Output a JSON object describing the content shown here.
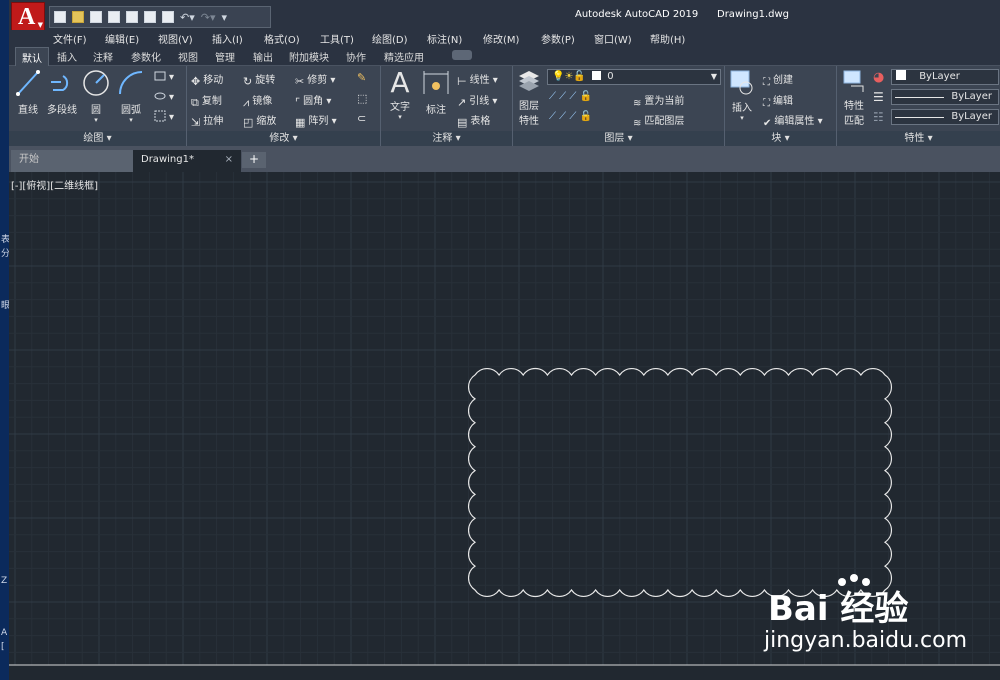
{
  "app": {
    "title": "Autodesk AutoCAD 2019",
    "document": "Drawing1.dwg",
    "logo_letter": "A"
  },
  "menu": [
    "文件(F)",
    "编辑(E)",
    "视图(V)",
    "插入(I)",
    "格式(O)",
    "工具(T)",
    "绘图(D)",
    "标注(N)",
    "修改(M)",
    "参数(P)",
    "窗口(W)",
    "帮助(H)"
  ],
  "ribbon_tabs": [
    "默认",
    "插入",
    "注释",
    "参数化",
    "视图",
    "管理",
    "输出",
    "附加模块",
    "协作",
    "精选应用"
  ],
  "ribbon": {
    "draw": {
      "title": "绘图 ▾",
      "line": "直线",
      "polyline": "多段线",
      "circle": "圆",
      "arc": "圆弧"
    },
    "modify": {
      "title": "修改 ▾",
      "move": "移动",
      "rotate": "旋转",
      "trim": "修剪",
      "copy": "复制",
      "mirror": "镜像",
      "fillet": "圆角",
      "stretch": "拉伸",
      "scale": "缩放",
      "array": "阵列"
    },
    "annotation": {
      "title": "注释 ▾",
      "text": "文字",
      "dimension": "标注",
      "linear": "线性",
      "leader": "引线",
      "table": "表格"
    },
    "layers": {
      "title": "图层 ▾",
      "properties_l1": "图层",
      "properties_l2": "特性",
      "current_layer": "0",
      "set_current": "置为当前",
      "match_layer": "匹配图层"
    },
    "block": {
      "title": "块 ▾",
      "insert": "插入",
      "create": "创建",
      "edit": "编辑",
      "edit_attributes": "编辑属性"
    },
    "properties": {
      "title": "特性 ▾",
      "match_l1": "特性",
      "match_l2": "匹配",
      "color": "ByLayer",
      "linetype": "ByLayer",
      "lineweight": "ByLayer"
    }
  },
  "doc_tabs": {
    "start": "开始",
    "drawing": "Drawing1*",
    "close": "×",
    "new": "+"
  },
  "viewport": {
    "label": "[-][俯视][二维线框]"
  },
  "left_strip": [
    "表",
    "分",
    "眼",
    "Z",
    "A",
    "["
  ],
  "watermark": {
    "text": "jingyan.baidu.com",
    "brand": "Bai 经验"
  },
  "colors": {
    "canvas": "#212830",
    "grid_minor": "#283039",
    "grid_major": "#303a45",
    "cloud": "#e8e8e8",
    "logo_red": "#c01a1a"
  }
}
